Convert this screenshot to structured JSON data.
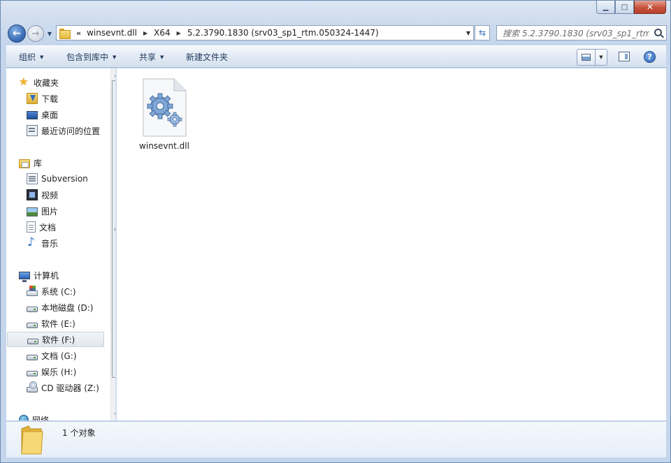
{
  "window": {
    "caption_buttons": {
      "minimize": "▁",
      "maximize": "□",
      "close": "✕"
    }
  },
  "address": {
    "overflow": "«",
    "crumbs": [
      "winsevnt.dll",
      "X64",
      "5.2.3790.1830 (srv03_sp1_rtm.050324-1447)"
    ]
  },
  "search": {
    "placeholder": "搜索 5.2.3790.1830 (srv03_sp1_rtm...",
    "icon": "search-icon"
  },
  "toolbar": {
    "organize": "组织",
    "include_in_library": "包含到库中",
    "share": "共享",
    "new_folder": "新建文件夹"
  },
  "nav": {
    "favorites": {
      "label": "收藏夹",
      "items": [
        "下载",
        "桌面",
        "最近访问的位置"
      ]
    },
    "libraries": {
      "label": "库",
      "items": [
        "Subversion",
        "视频",
        "图片",
        "文档",
        "音乐"
      ]
    },
    "computer": {
      "label": "计算机",
      "items": [
        "系统 (C:)",
        "本地磁盘 (D:)",
        "软件 (E:)",
        "软件 (F:)",
        "文档 (G:)",
        "娱乐 (H:)",
        "CD 驱动器 (Z:)"
      ],
      "selected": "软件 (F:)"
    },
    "network": {
      "label": "网络"
    }
  },
  "content": {
    "files": [
      {
        "name": "winsevnt.dll",
        "icon": "dll-settings-icon"
      }
    ]
  },
  "status": {
    "item_count": "1 个对象"
  },
  "colors": {
    "chrome": "#c5d6ec",
    "selection": "#e2e7ee",
    "accent_blue": "#2f6fbf"
  }
}
